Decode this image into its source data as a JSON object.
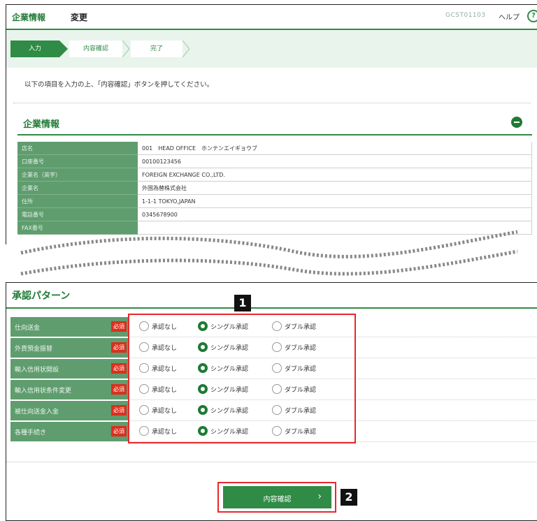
{
  "header": {
    "title": "企業情報",
    "action": "変更",
    "screen_code": "GCST01103",
    "help_label": "ヘルプ",
    "help_icon": "?"
  },
  "steps": [
    "入力",
    "内容確認",
    "完了"
  ],
  "instruction": "以下の項目を入力の上、「内容確認」ボタンを押してください。",
  "company_section": {
    "title": "企業情報",
    "rows": [
      {
        "label": "店名",
        "value": "001　HEAD OFFICE　ホンテンエイギョウブ"
      },
      {
        "label": "口座番号",
        "value": "00100123456"
      },
      {
        "label": "企業名（英字）",
        "value": "FOREIGN EXCHANGE CO.,LTD."
      },
      {
        "label": "企業名",
        "value": "外国為替株式会社"
      },
      {
        "label": "住所",
        "value": "1-1-1 TOKYO,JAPAN"
      },
      {
        "label": "電話番号",
        "value": "0345678900"
      },
      {
        "label": "FAX番号",
        "value": ""
      }
    ]
  },
  "approval_section": {
    "title": "承認パターン",
    "required_label": "必須",
    "options": [
      "承認なし",
      "シングル承認",
      "ダブル承認"
    ],
    "rows": [
      {
        "label": "仕向送金",
        "selected": "シングル承認"
      },
      {
        "label": "外貨預金振替",
        "selected": "シングル承認"
      },
      {
        "label": "輸入信用状開設",
        "selected": "シングル承認"
      },
      {
        "label": "輸入信用状条件変更",
        "selected": "シングル承認"
      },
      {
        "label": "被仕向送金入金",
        "selected": "シングル承認"
      },
      {
        "label": "各種手続き",
        "selected": "シングル承認"
      }
    ]
  },
  "badges": {
    "one": "1",
    "two": "2"
  },
  "confirm_button": {
    "label": "内容確認",
    "chevron": "›"
  },
  "colors": {
    "brand_green": "#2f8b45",
    "header_green": "#1e7a35",
    "label_bg": "#5f9d6e",
    "required_red": "#d9301f",
    "highlight_red": "#e8282b"
  }
}
